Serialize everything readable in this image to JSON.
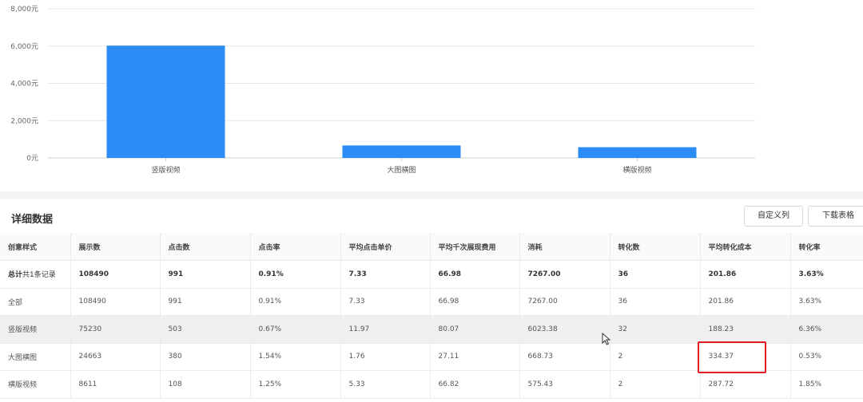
{
  "chart_data": {
    "type": "bar",
    "categories": [
      "竖版视频",
      "大图横图",
      "横版视频"
    ],
    "values": [
      6023.38,
      668.73,
      575.43
    ],
    "ylim": [
      0,
      8000
    ],
    "yticks": [
      0,
      2000,
      4000,
      6000,
      8000
    ],
    "ytick_labels": [
      "0元",
      "2,000元",
      "4,000元",
      "6,000元",
      "8,000元"
    ],
    "bar_color": "#2b8cf5",
    "grid": true
  },
  "chart_panel": {
    "right_text": ""
  },
  "section": {
    "title": "详细数据",
    "custom_columns_label": "自定义列",
    "download_label": "下载表格"
  },
  "table": {
    "columns": [
      "创意样式",
      "展示数",
      "点击数",
      "点击率",
      "平均点击单价",
      "平均千次展现费用",
      "消耗",
      "转化数",
      "平均转化成本",
      "转化率"
    ],
    "total_row": {
      "label_bold": "总计",
      "label_rest": "共1条记录",
      "values": [
        "108490",
        "991",
        "0.91%",
        "7.33",
        "66.98",
        "7267.00",
        "36",
        "201.86",
        "3.63%"
      ]
    },
    "rows": [
      [
        "全部",
        "108490",
        "991",
        "0.91%",
        "7.33",
        "66.98",
        "7267.00",
        "36",
        "201.86",
        "3.63%"
      ],
      [
        "竖版视频",
        "75230",
        "503",
        "0.67%",
        "11.97",
        "80.07",
        "6023.38",
        "32",
        "188.23",
        "6.36%"
      ],
      [
        "大图横图",
        "24663",
        "380",
        "1.54%",
        "1.76",
        "27.11",
        "668.73",
        "2",
        "334.37",
        "0.53%"
      ],
      [
        "横版视频",
        "8611",
        "108",
        "1.25%",
        "5.33",
        "66.82",
        "575.43",
        "2",
        "287.72",
        "1.85%"
      ]
    ]
  },
  "colors": {
    "highlight": "#e02020",
    "hover_row": "#efefef"
  }
}
